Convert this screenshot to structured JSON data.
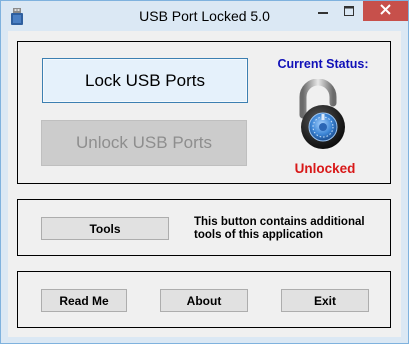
{
  "window": {
    "title": "USB Port Locked 5.0",
    "title_icon": "usb-drive-icon",
    "controls": [
      "minimize-icon",
      "maximize-icon",
      "close-icon"
    ],
    "accent_color": "#c7504b"
  },
  "main": {
    "lock_button": {
      "label": "Lock USB Ports",
      "mnemonic": "L"
    },
    "unlock_button": {
      "label": "Unlock USB Ports",
      "mnemonic": "U",
      "enabled": false
    },
    "status": {
      "label": "Current Status:",
      "value": "Unlocked",
      "icon": "open-padlock-icon",
      "label_color": "#1010b8",
      "value_color": "#d81818"
    }
  },
  "tools": {
    "button_label": "Tools",
    "mnemonic": "T",
    "description": "This button contains additional tools of this application"
  },
  "footer": {
    "readme_label": "Read Me",
    "about_label": "About",
    "exit_label": "Exit"
  }
}
